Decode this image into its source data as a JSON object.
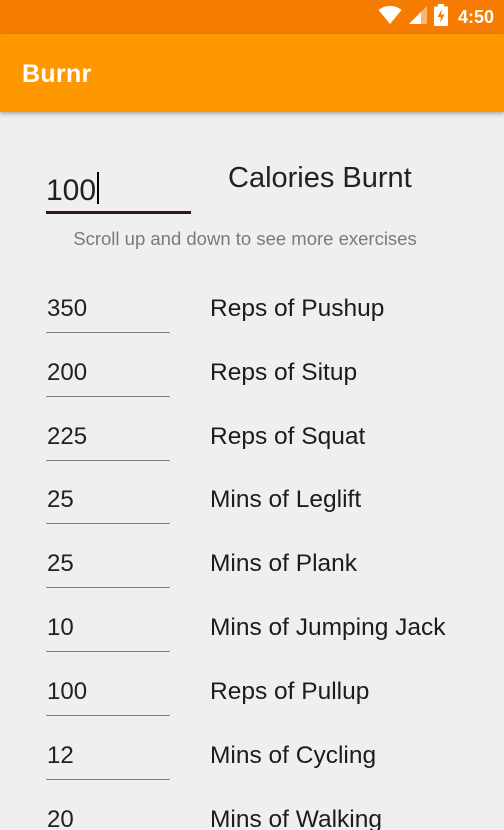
{
  "status_bar": {
    "time": "4:50",
    "icons": [
      "wifi-icon",
      "signal-icon",
      "battery-charging-icon"
    ]
  },
  "app_bar": {
    "title": "Burnr",
    "color": "#ff9800",
    "status_color": "#f57c00"
  },
  "calories": {
    "value": "100",
    "label": "Calories Burnt"
  },
  "hint": "Scroll up and down to see more exercises",
  "exercises": [
    {
      "value": "350",
      "label": "Reps of Pushup"
    },
    {
      "value": "200",
      "label": "Reps of Situp"
    },
    {
      "value": "225",
      "label": "Reps of Squat"
    },
    {
      "value": "25",
      "label": "Mins of Leglift"
    },
    {
      "value": "25",
      "label": "Mins of Plank"
    },
    {
      "value": "10",
      "label": "Mins of Jumping Jack"
    },
    {
      "value": "100",
      "label": "Reps of Pullup"
    },
    {
      "value": "12",
      "label": "Mins of Cycling"
    },
    {
      "value": "20",
      "label": "Mins of Walking"
    }
  ]
}
